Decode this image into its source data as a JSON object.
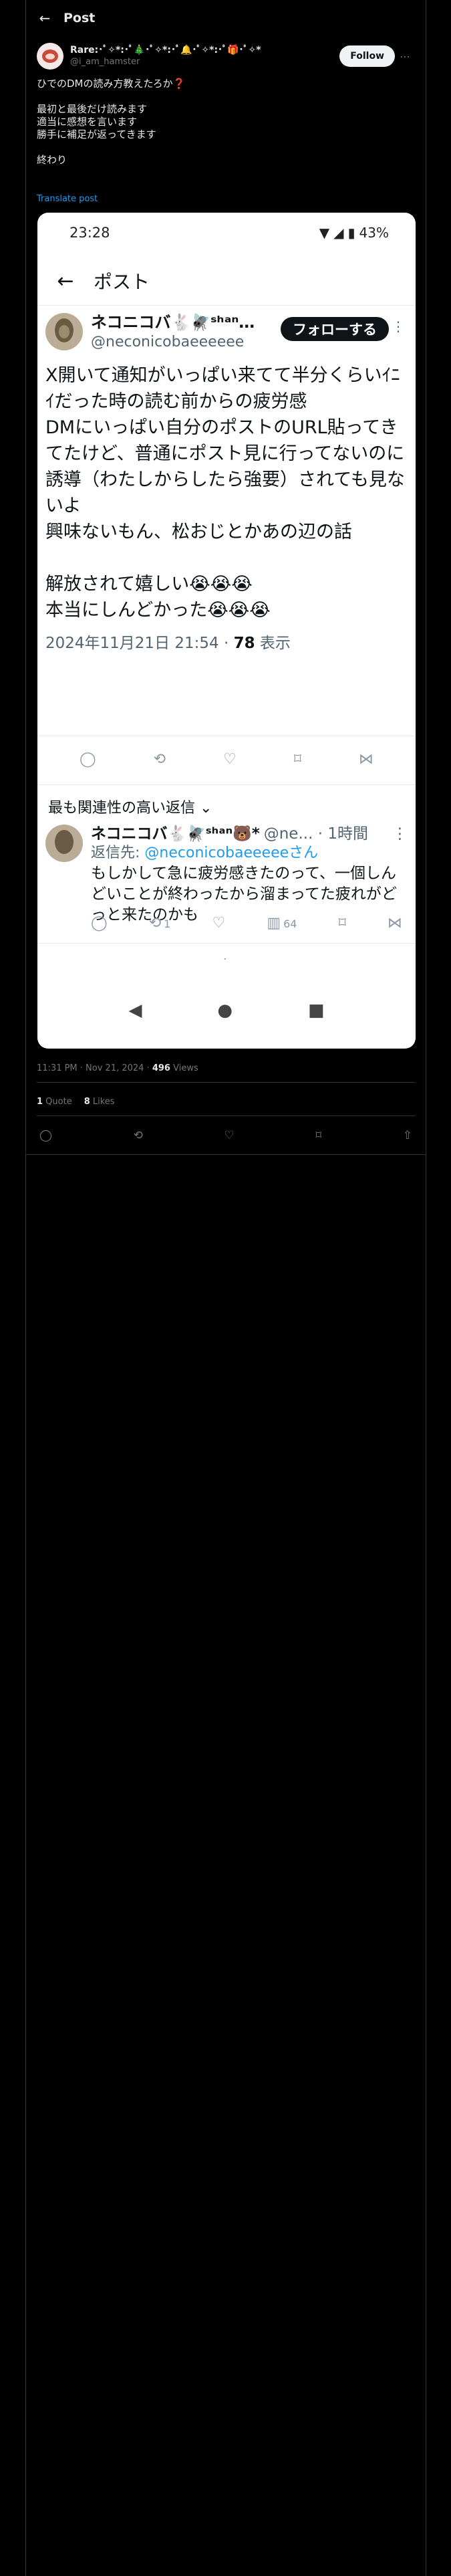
{
  "header": {
    "back_icon": "arrow-left-icon",
    "title": "Post"
  },
  "author": {
    "display_name": "Rare:･ﾟ✧*:･ﾟ🎄･ﾟ✧*:･ﾟ🔔･ﾟ✧*:･ﾟ🎁･ﾟ✧*",
    "handle": "@i_am_hamster",
    "follow_label": "Follow",
    "more_icon": "more-icon"
  },
  "post": {
    "lines": [
      "ひでのDMの読み方教えたろか❓",
      "",
      "最初と最後だけ読みます",
      "適当に感想を言います",
      "勝手に補足が返ってきます",
      "",
      "終わり"
    ],
    "translate_label": "Translate post"
  },
  "screenshot": {
    "time": "23:28",
    "battery": "43%",
    "nav_title": "ポスト",
    "tweet": {
      "name": "ネコニコバ🐇🪰ˢʰᵃⁿ…",
      "handle": "@neconicobaeeeeee",
      "follow_label": "フォローする",
      "lines": [
        "X開いて通知がいっぱい来てて半分くらいｲﾆｲだった時の読む前からの疲労感",
        "DMにいっぱい自分のポストのURL貼ってきてたけど、普通にポスト見に行ってないのに誘導（わたしからしたら強要）されても見ないよ",
        "興味ないもん、松おじとかあの辺の話",
        "",
        "解放されて嬉しい😭😭😭",
        "本当にしんどかった😭😭😭"
      ],
      "timestamp": "2024年11月21日 21:54 · ",
      "views_count": "78",
      "views_label": " 表示"
    },
    "relevant_label": "最も関連性の高い返信 ⌄",
    "reply": {
      "name": "ネコニコバ🐇🪰ˢʰᵃⁿ🐻*",
      "meta": "@ne... · 1時間",
      "reply_to_prefix": "返信先: ",
      "reply_to_handle": "@neconicobaeeeeeさん",
      "text": "もしかして急に疲労感きたのって、一個しんどいことが終わったから溜まってた疲れがどっと来たのかも",
      "retweets": "1",
      "views": "64"
    },
    "page_dot": "·"
  },
  "footer": {
    "time": "11:31 PM · Nov 21, 2024 · ",
    "views_count": "496",
    "views_label": " Views",
    "quotes_count": "1",
    "quotes_label": " Quote",
    "likes_count": "8",
    "likes_label": " Likes"
  },
  "colors": {
    "accent": "#1d9bf0",
    "background": "#000000",
    "muted": "#71767b"
  }
}
